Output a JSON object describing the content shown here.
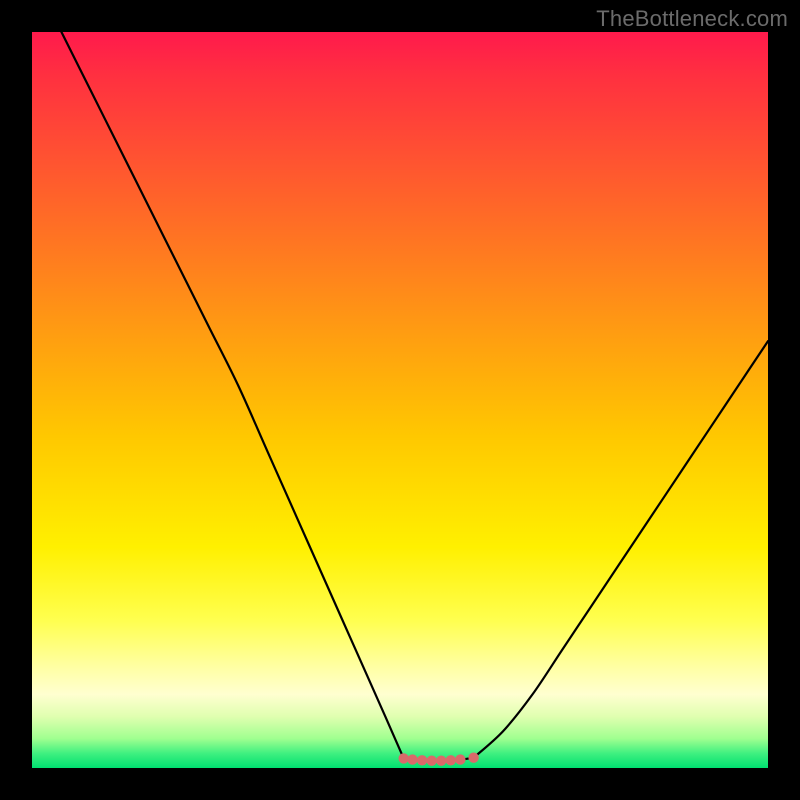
{
  "watermark": "TheBottleneck.com",
  "colors": {
    "frame": "#000000",
    "curve": "#000000",
    "valley_dots": "#d96a6a",
    "gradient_top": "#ff1a4c",
    "gradient_bottom": "#00e070"
  },
  "chart_data": {
    "type": "line",
    "title": "",
    "xlabel": "",
    "ylabel": "",
    "x_range": [
      0,
      100
    ],
    "y_range": [
      0,
      100
    ],
    "series": [
      {
        "name": "left-curve",
        "x": [
          4,
          8,
          12,
          16,
          20,
          24,
          28,
          32,
          36,
          40,
          44,
          48,
          50.5
        ],
        "y": [
          100,
          92,
          84,
          76,
          68,
          60,
          52,
          43,
          34,
          25,
          16,
          7,
          1.3
        ]
      },
      {
        "name": "valley-floor",
        "x": [
          50.5,
          52,
          54,
          56,
          58,
          60
        ],
        "y": [
          1.3,
          1.1,
          1.0,
          1.0,
          1.1,
          1.4
        ]
      },
      {
        "name": "right-curve",
        "x": [
          60,
          64,
          68,
          72,
          76,
          80,
          84,
          88,
          92,
          96,
          100
        ],
        "y": [
          1.4,
          5,
          10,
          16,
          22,
          28,
          34,
          40,
          46,
          52,
          58
        ]
      }
    ],
    "markers": {
      "name": "valley-dots",
      "x": [
        50.5,
        51.7,
        53.0,
        54.3,
        55.6,
        56.9,
        58.2,
        60.0
      ],
      "y": [
        1.3,
        1.15,
        1.05,
        1.0,
        1.0,
        1.05,
        1.15,
        1.4
      ]
    }
  }
}
